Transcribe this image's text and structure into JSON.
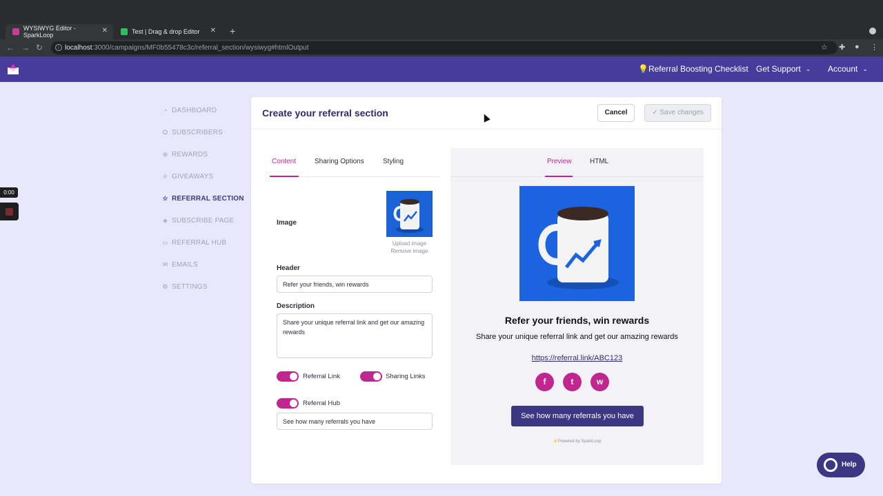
{
  "browser": {
    "tabs": [
      {
        "title": "WYSIWYG Editor - SparkLoop",
        "active": true
      },
      {
        "title": "Test | Drag & drop Editor",
        "active": false
      }
    ],
    "url_host": "localhost",
    "url_path": ":3000/campaigns/MF0b55478c3c/referral_section/wysiwyg#htmlOutput"
  },
  "header": {
    "checklist": "💡Referral Boosting Checklist",
    "support": "Get Support",
    "account": "Account"
  },
  "sidebar": {
    "items": [
      {
        "label": "DASHBOARD",
        "icon": "dashboard-icon"
      },
      {
        "label": "SUBSCRIBERS",
        "icon": "users-icon"
      },
      {
        "label": "REWARDS",
        "icon": "gift-icon"
      },
      {
        "label": "GIVEAWAYS",
        "icon": "trophy-icon"
      },
      {
        "label": "REFERRAL SECTION",
        "icon": "star-icon",
        "active": true
      },
      {
        "label": "SUBSCRIBE PAGE",
        "icon": "layers-icon"
      },
      {
        "label": "REFERRAL HUB",
        "icon": "hub-icon"
      },
      {
        "label": "EMAILS",
        "icon": "mail-icon"
      },
      {
        "label": "SETTINGS",
        "icon": "gear-icon"
      }
    ]
  },
  "recorder": {
    "time": "0:00"
  },
  "editor": {
    "title": "Create your referral section",
    "cancel": "Cancel",
    "save": "✓ Save changes",
    "tabs": [
      "Content",
      "Sharing Options",
      "Styling"
    ],
    "image_label": "Image",
    "upload": "Upload image",
    "remove": "Remove image",
    "header_label": "Header",
    "header_value": "Refer your friends, win rewards",
    "description_label": "Description",
    "description_value": "Share your unique referral link and get our amazing rewards",
    "toggles": {
      "referral_link": "Referral Link",
      "sharing_links": "Sharing Links",
      "referral_hub": "Referral Hub"
    },
    "hub_value": "See how many referrals you have"
  },
  "preview": {
    "tabs": [
      "Preview",
      "HTML"
    ],
    "title": "Refer your friends, win rewards",
    "description": "Share your unique referral link and get our amazing rewards",
    "link": "https://referral.link/ABC123",
    "social": [
      "f",
      "t",
      "w"
    ],
    "button": "See how many referrals you have",
    "powered": "⚡Powered by SparkLoop"
  },
  "help": {
    "label": "Help"
  },
  "colors": {
    "brand": "#473c9b",
    "accent": "#c0268e",
    "dark": "#3b3783"
  }
}
